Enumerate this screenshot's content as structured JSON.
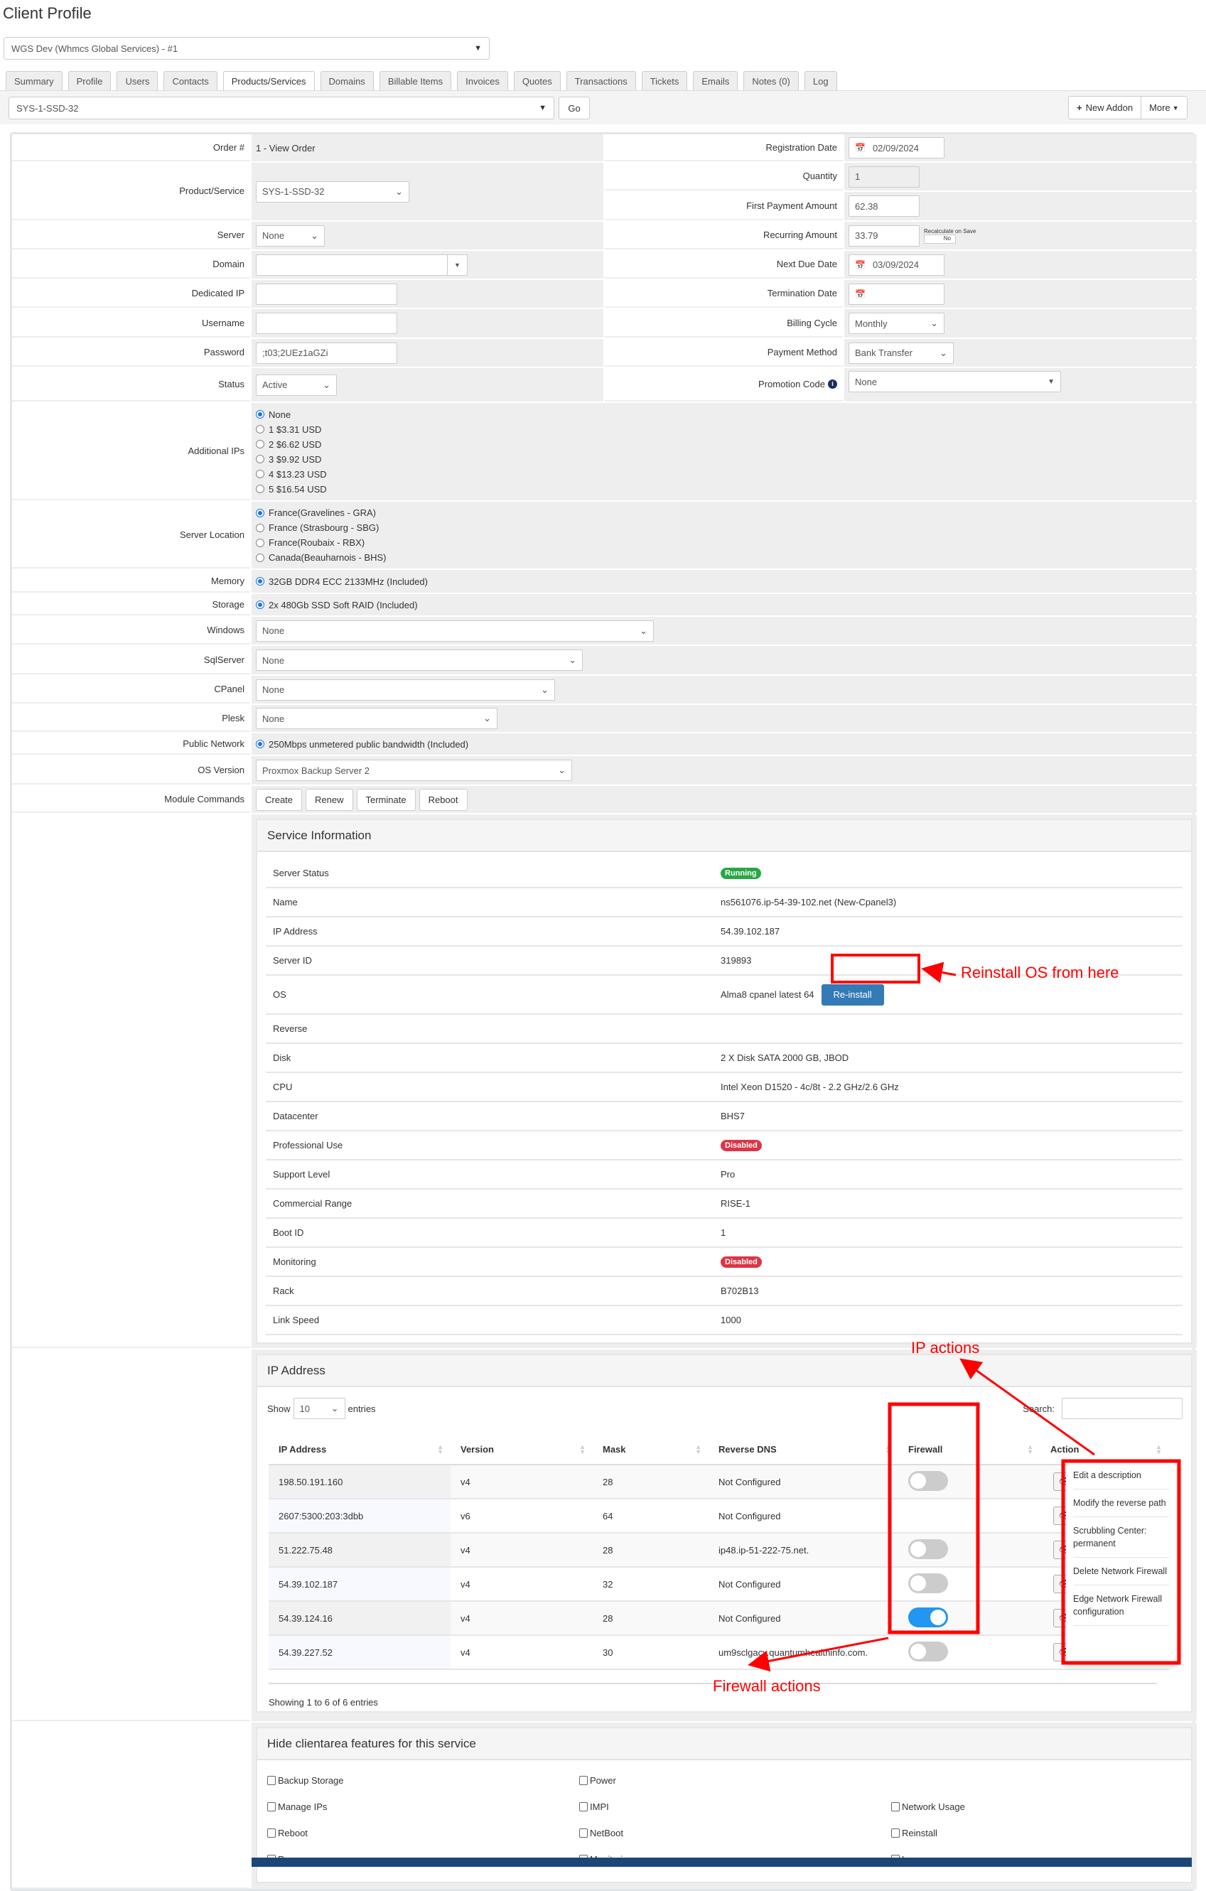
{
  "page_title": "Client Profile",
  "client_select": "WGS Dev (Whmcs Global Services) - #1",
  "tabs": [
    "Summary",
    "Profile",
    "Users",
    "Contacts",
    "Products/Services",
    "Domains",
    "Billable Items",
    "Invoices",
    "Quotes",
    "Transactions",
    "Tickets",
    "Emails",
    "Notes (0)",
    "Log"
  ],
  "active_tab": "Products/Services",
  "toolbar": {
    "product_select": "SYS-1-SSD-32",
    "go": "Go",
    "new_addon": "New Addon",
    "more": "More"
  },
  "form": {
    "order_label": "Order #",
    "order_value": "1 - View Order",
    "product_label": "Product/Service",
    "product_value": "SYS-1-SSD-32",
    "server_label": "Server",
    "server_value": "None",
    "domain_label": "Domain",
    "domain_value": "",
    "dedicated_ip_label": "Dedicated IP",
    "dedicated_ip_value": "",
    "username_label": "Username",
    "username_value": "",
    "password_label": "Password",
    "password_value": ";t03;2UEz1aGZi",
    "status_label": "Status",
    "status_value": "Active",
    "reg_date_label": "Registration Date",
    "reg_date_value": "02/09/2024",
    "quantity_label": "Quantity",
    "quantity_value": "1",
    "first_payment_label": "First Payment Amount",
    "first_payment_value": "62.38",
    "recurring_label": "Recurring Amount",
    "recurring_value": "33.79",
    "recalc_label": "Recalculate on Save",
    "recalc_toggle": "No",
    "next_due_label": "Next Due Date",
    "next_due_value": "03/09/2024",
    "termination_label": "Termination Date",
    "termination_value": "",
    "billing_cycle_label": "Billing Cycle",
    "billing_cycle_value": "Monthly",
    "payment_method_label": "Payment Method",
    "payment_method_value": "Bank Transfer",
    "promo_label": "Promotion Code",
    "promo_value": "None",
    "additional_ips_label": "Additional IPs",
    "additional_ips": [
      "None",
      "1 $3.31 USD",
      "2 $6.62 USD",
      "3 $9.92 USD",
      "4 $13.23 USD",
      "5 $16.54 USD"
    ],
    "additional_ips_selected": 0,
    "server_location_label": "Server Location",
    "server_locations": [
      "France(Gravelines - GRA)",
      "France (Strasbourg - SBG)",
      "France(Roubaix - RBX)",
      "Canada(Beauharnois - BHS)"
    ],
    "server_location_selected": 0,
    "memory_label": "Memory",
    "memory_value": "32GB DDR4 ECC 2133MHz (Included)",
    "storage_label": "Storage",
    "storage_value": "2x 480Gb SSD Soft RAID (Included)",
    "windows_label": "Windows",
    "windows_value": "None",
    "sqlserver_label": "SqlServer",
    "sqlserver_value": "None",
    "cpanel_label": "CPanel",
    "cpanel_value": "None",
    "plesk_label": "Plesk",
    "plesk_value": "None",
    "public_network_label": "Public Network",
    "public_network_value": "250Mbps unmetered public bandwidth (Included)",
    "os_version_label": "OS Version",
    "os_version_value": "Proxmox Backup Server 2",
    "module_commands_label": "Module Commands",
    "module_commands": [
      "Create",
      "Renew",
      "Terminate",
      "Reboot"
    ]
  },
  "service_info": {
    "title": "Service Information",
    "rows": [
      {
        "label": "Server Status",
        "value": "Running",
        "badge": "#28a745"
      },
      {
        "label": "Name",
        "value": "ns561076.ip-54-39-102.net (New-Cpanel3)"
      },
      {
        "label": "IP Address",
        "value": "54.39.102.187"
      },
      {
        "label": "Server ID",
        "value": "319893"
      },
      {
        "label": "OS",
        "value": "Alma8 cpanel latest 64",
        "button": "Re-install"
      },
      {
        "label": "Reverse",
        "value": ""
      },
      {
        "label": "Disk",
        "value": "2 X Disk SATA 2000 GB, JBOD"
      },
      {
        "label": "CPU",
        "value": "Intel Xeon D1520 - 4c/8t - 2.2 GHz/2.6 GHz"
      },
      {
        "label": "Datacenter",
        "value": "BHS7"
      },
      {
        "label": "Professional Use",
        "value": "Disabled",
        "badge": "#dc3545"
      },
      {
        "label": "Support Level",
        "value": "Pro"
      },
      {
        "label": "Commercial Range",
        "value": "RISE-1"
      },
      {
        "label": "Boot ID",
        "value": "1"
      },
      {
        "label": "Monitoring",
        "value": "Disabled",
        "badge": "#dc3545"
      },
      {
        "label": "Rack",
        "value": "B702B13"
      },
      {
        "label": "Link Speed",
        "value": "1000"
      }
    ]
  },
  "ip_section": {
    "title": "IP Address",
    "show": "Show",
    "entries_value": "10",
    "entries": "entries",
    "search": "Search:",
    "columns": [
      "IP Address",
      "Version",
      "Mask",
      "Reverse DNS",
      "Firewall",
      "Action"
    ],
    "rows": [
      {
        "ip": "198.50.191.160",
        "version": "v4",
        "mask": "28",
        "rdns": "Not Configured",
        "firewall": false
      },
      {
        "ip": "2607:5300:203:3dbb",
        "version": "v6",
        "mask": "64",
        "rdns": "Not Configured",
        "firewall": null
      },
      {
        "ip": "51.222.75.48",
        "version": "v4",
        "mask": "28",
        "rdns": "ip48.ip-51-222-75.net.",
        "firewall": false
      },
      {
        "ip": "54.39.102.187",
        "version": "v4",
        "mask": "32",
        "rdns": "Not Configured",
        "firewall": false
      },
      {
        "ip": "54.39.124.16",
        "version": "v4",
        "mask": "28",
        "rdns": "Not Configured",
        "firewall": true
      },
      {
        "ip": "54.39.227.52",
        "version": "v4",
        "mask": "30",
        "rdns": "um9sclgacy.quantumhealthinfo.com.",
        "firewall": false
      }
    ],
    "footer": "Showing 1 to 6 of 6 entries",
    "menu": [
      "Edit a description",
      "Modify the reverse path",
      "Scrubbling Center: permanent",
      "Delete Network Firewall",
      "Edge Network Firewall configuration"
    ]
  },
  "hide_features": {
    "title": "Hide clientarea features for this service",
    "items": [
      [
        "Backup Storage",
        "Power",
        ""
      ],
      [
        "Manage IPs",
        "IMPI",
        "Network Usage"
      ],
      [
        "Reboot",
        "NetBoot",
        "Reinstall"
      ],
      [
        "Rescue",
        "Monitoring",
        "Logs"
      ]
    ]
  },
  "annotations": {
    "reinstall": "Reinstall OS from here",
    "ip_actions": "IP actions",
    "firewall_actions": "Firewall actions",
    "color": "#ff0000"
  }
}
